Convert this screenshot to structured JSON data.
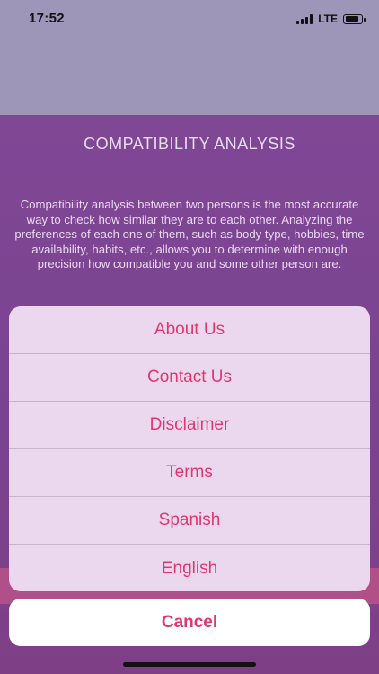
{
  "status_bar": {
    "time": "17:52",
    "network": "LTE"
  },
  "page": {
    "title": "COMPATIBILITY ANALYSIS",
    "description": "Compatibility analysis between two persons is the most accurate way to check how similar they are to each other. Analyzing the preferences of each one of them, such as body type, hobbies, time availability, habits, etc., allows you to determine with enough precision how compatible you and some other person are."
  },
  "action_sheet": {
    "items": [
      {
        "label": "About Us"
      },
      {
        "label": "Contact Us"
      },
      {
        "label": "Disclaimer"
      },
      {
        "label": "Terms"
      },
      {
        "label": "Spanish"
      },
      {
        "label": "English"
      }
    ],
    "cancel_label": "Cancel"
  },
  "colors": {
    "accent": "#e2366f",
    "panel": "#7f4794",
    "sheet_bg": "#ecd8ee"
  }
}
